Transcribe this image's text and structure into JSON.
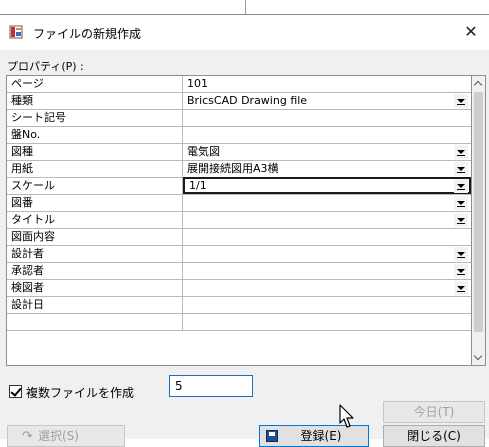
{
  "window": {
    "title": "ファイルの新規作成",
    "close_glyph": "✕"
  },
  "properties_label": "プロパティ(P) :",
  "rows": [
    {
      "name": "ページ",
      "value": "101",
      "dropdown": false
    },
    {
      "name": "種類",
      "value": "BricsCAD Drawing file",
      "dropdown": true
    },
    {
      "name": "シート記号",
      "value": "",
      "dropdown": false
    },
    {
      "name": "盤No.",
      "value": "",
      "dropdown": false
    },
    {
      "name": "図種",
      "value": "電気図",
      "dropdown": true
    },
    {
      "name": "用紙",
      "value": "展開接続図用A3横",
      "dropdown": true
    },
    {
      "name": "スケール",
      "value": "1/1",
      "dropdown": true,
      "active": true
    },
    {
      "name": "図番",
      "value": "",
      "dropdown": true
    },
    {
      "name": "タイトル",
      "value": "",
      "dropdown": true
    },
    {
      "name": "図面内容",
      "value": "",
      "dropdown": false
    },
    {
      "name": "設計者",
      "value": "",
      "dropdown": true
    },
    {
      "name": "承認者",
      "value": "",
      "dropdown": true
    },
    {
      "name": "検図者",
      "value": "",
      "dropdown": true
    },
    {
      "name": "設計日",
      "value": "",
      "dropdown": false
    },
    {
      "name": "",
      "value": "",
      "dropdown": false
    }
  ],
  "multi_file": {
    "checked": true,
    "label": "複数ファイルを作成",
    "count": "5"
  },
  "buttons": {
    "today": "今日(T)",
    "select": "選択(S)",
    "register": "登録(E)",
    "close": "閉じる(C)"
  },
  "icons": {
    "app": "app-icon",
    "select": "select-arrow-icon",
    "register": "floppy-disk-icon",
    "cursor": "mouse-pointer-icon"
  }
}
